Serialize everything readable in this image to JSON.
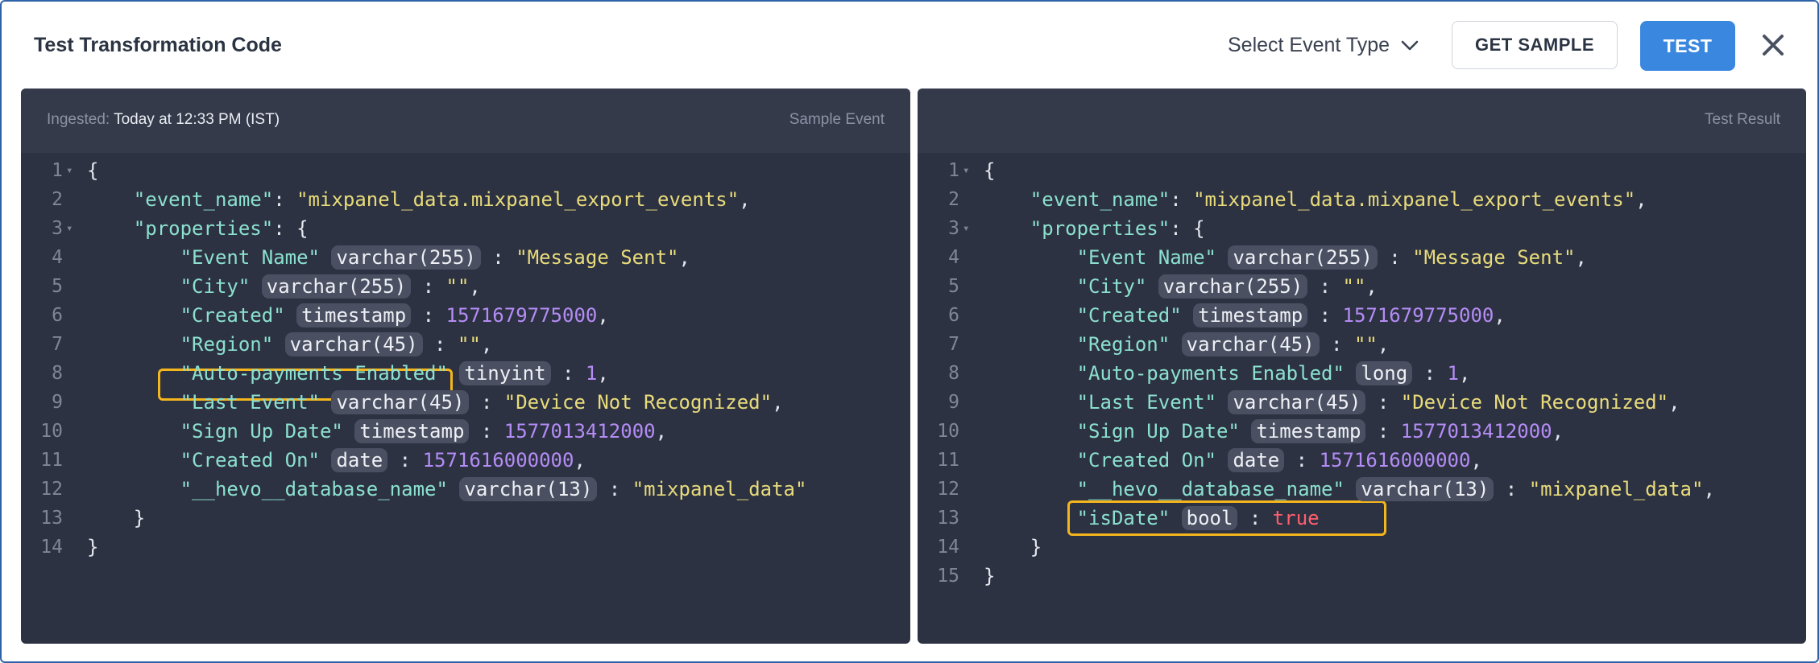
{
  "dialog": {
    "title": "Test Transformation Code",
    "event_type_label": "Select Event Type",
    "get_sample_label": "GET SAMPLE",
    "test_label": "TEST"
  },
  "left_panel": {
    "ingested_label": "Ingested:",
    "ingested_value": "Today at 12:33 PM (IST)",
    "label": "Sample Event"
  },
  "right_panel": {
    "label": "Test Result"
  },
  "code_left": [
    {
      "n": "1",
      "fold": true,
      "ind": 0,
      "t": [
        [
          "p",
          "{"
        ]
      ]
    },
    {
      "n": "2",
      "ind": 1,
      "t": [
        [
          "k",
          "\"event_name\""
        ],
        [
          "p",
          ": "
        ],
        [
          "s",
          "\"mixpanel_data.mixpanel_export_events\""
        ],
        [
          "p",
          ","
        ]
      ]
    },
    {
      "n": "3",
      "fold": true,
      "ind": 1,
      "t": [
        [
          "k",
          "\"properties\""
        ],
        [
          "p",
          ": {"
        ]
      ]
    },
    {
      "n": "4",
      "ind": 2,
      "t": [
        [
          "k",
          "\"Event Name\""
        ],
        [
          "p",
          " "
        ],
        [
          "tag",
          "varchar(255)"
        ],
        [
          "p",
          " : "
        ],
        [
          "s",
          "\"Message Sent\""
        ],
        [
          "p",
          ","
        ]
      ]
    },
    {
      "n": "5",
      "ind": 2,
      "t": [
        [
          "k",
          "\"City\""
        ],
        [
          "p",
          " "
        ],
        [
          "tag",
          "varchar(255)"
        ],
        [
          "p",
          " : "
        ],
        [
          "s",
          "\"\""
        ],
        [
          "p",
          ","
        ]
      ]
    },
    {
      "n": "6",
      "ind": 2,
      "t": [
        [
          "k",
          "\"Created\""
        ],
        [
          "p",
          " "
        ],
        [
          "tag",
          "timestamp"
        ],
        [
          "p",
          " : "
        ],
        [
          "n",
          "1571679775000"
        ],
        [
          "p",
          ","
        ]
      ]
    },
    {
      "n": "7",
      "ind": 2,
      "t": [
        [
          "k",
          "\"Region\""
        ],
        [
          "p",
          " "
        ],
        [
          "tag",
          "varchar(45)"
        ],
        [
          "p",
          " : "
        ],
        [
          "s",
          "\"\""
        ],
        [
          "p",
          ","
        ]
      ]
    },
    {
      "n": "8",
      "ind": 2,
      "t": [
        [
          "k",
          "\"Auto-payments Enabled\""
        ],
        [
          "p",
          " "
        ],
        [
          "tag",
          "tinyint"
        ],
        [
          "p",
          " : "
        ],
        [
          "n",
          "1"
        ],
        [
          "p",
          ","
        ]
      ]
    },
    {
      "n": "9",
      "ind": 2,
      "t": [
        [
          "k",
          "\"Last Event\""
        ],
        [
          "p",
          " "
        ],
        [
          "tag",
          "varchar(45)"
        ],
        [
          "p",
          " : "
        ],
        [
          "s",
          "\"Device Not Recognized\""
        ],
        [
          "p",
          ","
        ]
      ]
    },
    {
      "n": "10",
      "ind": 2,
      "t": [
        [
          "k",
          "\"Sign Up Date\""
        ],
        [
          "p",
          " "
        ],
        [
          "tag",
          "timestamp"
        ],
        [
          "p",
          " : "
        ],
        [
          "n",
          "1577013412000"
        ],
        [
          "p",
          ","
        ]
      ]
    },
    {
      "n": "11",
      "ind": 2,
      "t": [
        [
          "k",
          "\"Created On\""
        ],
        [
          "p",
          " "
        ],
        [
          "tag",
          "date"
        ],
        [
          "p",
          " : "
        ],
        [
          "n",
          "1571616000000"
        ],
        [
          "p",
          ","
        ]
      ]
    },
    {
      "n": "12",
      "ind": 2,
      "t": [
        [
          "k",
          "\"__hevo__database_name\""
        ],
        [
          "p",
          " "
        ],
        [
          "tag",
          "varchar(13)"
        ],
        [
          "p",
          " : "
        ],
        [
          "s",
          "\"mixpanel_data\""
        ]
      ]
    },
    {
      "n": "13",
      "ind": 1,
      "t": [
        [
          "p",
          "}"
        ]
      ]
    },
    {
      "n": "14",
      "ind": 0,
      "t": [
        [
          "p",
          "}"
        ]
      ]
    }
  ],
  "code_right": [
    {
      "n": "1",
      "fold": true,
      "ind": 0,
      "t": [
        [
          "p",
          "{"
        ]
      ]
    },
    {
      "n": "2",
      "ind": 1,
      "t": [
        [
          "k",
          "\"event_name\""
        ],
        [
          "p",
          ": "
        ],
        [
          "s",
          "\"mixpanel_data.mixpanel_export_events\""
        ],
        [
          "p",
          ","
        ]
      ]
    },
    {
      "n": "3",
      "fold": true,
      "ind": 1,
      "t": [
        [
          "k",
          "\"properties\""
        ],
        [
          "p",
          ": {"
        ]
      ]
    },
    {
      "n": "4",
      "ind": 2,
      "t": [
        [
          "k",
          "\"Event Name\""
        ],
        [
          "p",
          " "
        ],
        [
          "tag",
          "varchar(255)"
        ],
        [
          "p",
          " : "
        ],
        [
          "s",
          "\"Message Sent\""
        ],
        [
          "p",
          ","
        ]
      ]
    },
    {
      "n": "5",
      "ind": 2,
      "t": [
        [
          "k",
          "\"City\""
        ],
        [
          "p",
          " "
        ],
        [
          "tag",
          "varchar(255)"
        ],
        [
          "p",
          " : "
        ],
        [
          "s",
          "\"\""
        ],
        [
          "p",
          ","
        ]
      ]
    },
    {
      "n": "6",
      "ind": 2,
      "t": [
        [
          "k",
          "\"Created\""
        ],
        [
          "p",
          " "
        ],
        [
          "tag",
          "timestamp"
        ],
        [
          "p",
          " : "
        ],
        [
          "n",
          "1571679775000"
        ],
        [
          "p",
          ","
        ]
      ]
    },
    {
      "n": "7",
      "ind": 2,
      "t": [
        [
          "k",
          "\"Region\""
        ],
        [
          "p",
          " "
        ],
        [
          "tag",
          "varchar(45)"
        ],
        [
          "p",
          " : "
        ],
        [
          "s",
          "\"\""
        ],
        [
          "p",
          ","
        ]
      ]
    },
    {
      "n": "8",
      "ind": 2,
      "t": [
        [
          "k",
          "\"Auto-payments Enabled\""
        ],
        [
          "p",
          " "
        ],
        [
          "tag",
          "long"
        ],
        [
          "p",
          " : "
        ],
        [
          "n",
          "1"
        ],
        [
          "p",
          ","
        ]
      ]
    },
    {
      "n": "9",
      "ind": 2,
      "t": [
        [
          "k",
          "\"Last Event\""
        ],
        [
          "p",
          " "
        ],
        [
          "tag",
          "varchar(45)"
        ],
        [
          "p",
          " : "
        ],
        [
          "s",
          "\"Device Not Recognized\""
        ],
        [
          "p",
          ","
        ]
      ]
    },
    {
      "n": "10",
      "ind": 2,
      "t": [
        [
          "k",
          "\"Sign Up Date\""
        ],
        [
          "p",
          " "
        ],
        [
          "tag",
          "timestamp"
        ],
        [
          "p",
          " : "
        ],
        [
          "n",
          "1577013412000"
        ],
        [
          "p",
          ","
        ]
      ]
    },
    {
      "n": "11",
      "ind": 2,
      "t": [
        [
          "k",
          "\"Created On\""
        ],
        [
          "p",
          " "
        ],
        [
          "tag",
          "date"
        ],
        [
          "p",
          " : "
        ],
        [
          "n",
          "1571616000000"
        ],
        [
          "p",
          ","
        ]
      ]
    },
    {
      "n": "12",
      "ind": 2,
      "t": [
        [
          "k",
          "\"__hevo__database_name\""
        ],
        [
          "p",
          " "
        ],
        [
          "tag",
          "varchar(13)"
        ],
        [
          "p",
          " : "
        ],
        [
          "s",
          "\"mixpanel_data\""
        ],
        [
          "p",
          ","
        ]
      ]
    },
    {
      "n": "13",
      "ind": 2,
      "t": [
        [
          "k",
          "\"isDate\""
        ],
        [
          "p",
          " "
        ],
        [
          "tag",
          "bool"
        ],
        [
          "p",
          " : "
        ],
        [
          "b",
          "true"
        ]
      ]
    },
    {
      "n": "14",
      "ind": 1,
      "t": [
        [
          "p",
          "}"
        ]
      ]
    },
    {
      "n": "15",
      "ind": 0,
      "t": [
        [
          "p",
          "}"
        ]
      ]
    }
  ],
  "colors": {
    "accent": "#3a87e0",
    "highlight": "#f4b51d",
    "editor_bg": "#2d3242"
  }
}
